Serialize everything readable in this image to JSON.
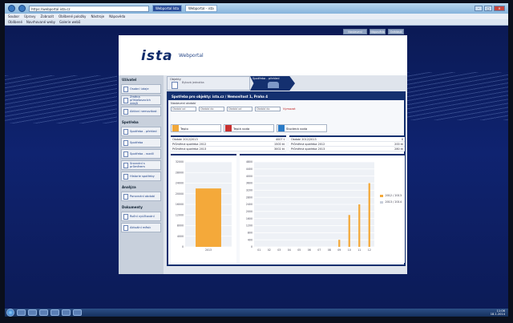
{
  "browser": {
    "address": "https://webportal.ista.cz",
    "tabs": [
      {
        "label": "Webportal Ista"
      },
      {
        "label": "Webportal - ista"
      }
    ],
    "menu": [
      "Soubor",
      "Úpravy",
      "Zobrazit",
      "Oblíbené položky",
      "Nástroje",
      "Nápověda"
    ],
    "favorites": [
      "Oblíbené",
      "Navrhované weby",
      "Galerie webů"
    ]
  },
  "header": {
    "logo": "ista",
    "portal_title": "Webportal",
    "buttons": [
      "Nastavení",
      "Nápověda",
      "Odhlásit"
    ]
  },
  "sidebar": {
    "sections": [
      {
        "title": "Uživatel",
        "items": [
          "Osobní údaje",
          "Změna přihlašovacích údajů",
          "Aktivní nemovitost"
        ]
      },
      {
        "title": "Spotřeba",
        "items": [
          "Spotřeba - přehled",
          "Spotřeba",
          "Spotřeba - rozdíl"
        ]
      },
      {
        "title": "",
        "items": [
          "Srovnání s průměrem",
          "Historie spotřeby"
        ]
      },
      {
        "title": "Analýza",
        "items": [
          "Porovnání období"
        ]
      },
      {
        "title": "Dokumenty",
        "items": [
          "Roční vyúčtování",
          "Aktuální měsíc"
        ]
      }
    ]
  },
  "steps": {
    "step1_title": "Objekty",
    "step1_sub": "Bytová jednotka",
    "step2_title": "Spotřeba - přehled"
  },
  "panel": {
    "title": "Spotřeba pro objekty: ista.cz / Nemovitost 1, Praha 4",
    "filter_label": "Nastavení období",
    "filters": [
      "Období od",
      "Období do",
      "Období od",
      "Období do"
    ],
    "reset": "Vymazat"
  },
  "cards": [
    {
      "label": "Teplo",
      "color": "#f2a93b"
    },
    {
      "label": "Teplá voda",
      "color": "#c8302f"
    },
    {
      "label": "Studená voda",
      "color": "#2a7bc7"
    }
  ],
  "tables": {
    "left": [
      {
        "k": "Období 2012/2013",
        "v": "4007 t"
      },
      {
        "k": "Průměrná spotřeba 2012",
        "v": "1500 kt"
      },
      {
        "k": "Průměrná spotřeba 2013",
        "v": "3002 kt"
      }
    ],
    "right": [
      {
        "k": "Období 2012/2013",
        "v": "0"
      },
      {
        "k": "Průměrná spotřeba 2012",
        "v": "200 kt"
      },
      {
        "k": "Průměrná spotřeba 2013",
        "v": "280 kt"
      }
    ]
  },
  "chart_data": [
    {
      "type": "bar",
      "categories": [
        "2013"
      ],
      "values": [
        22000
      ],
      "ylim": [
        0,
        32000
      ],
      "yticks": [
        0,
        4000,
        8000,
        12000,
        16000,
        20000,
        24000,
        28000,
        32000
      ],
      "color": "#f4a93a"
    },
    {
      "type": "bar",
      "categories": [
        "01",
        "02",
        "03",
        "04",
        "05",
        "06",
        "07",
        "08",
        "09",
        "10",
        "11",
        "12"
      ],
      "series": [
        {
          "name": "2012 / 2013",
          "color": "#f4a93a",
          "values": [
            0,
            0,
            0,
            0,
            0,
            0,
            0,
            0,
            400,
            1800,
            2400,
            3600
          ]
        },
        {
          "name": "2013 / 2014",
          "color": "#c9cfdb",
          "values": [
            0,
            0,
            0,
            0,
            0,
            0,
            0,
            0,
            0,
            0,
            0,
            0
          ]
        }
      ],
      "ylim": [
        0,
        4800
      ],
      "yticks": [
        0,
        400,
        800,
        1200,
        1600,
        2000,
        2400,
        2800,
        3200,
        3600,
        4000,
        4400,
        4800
      ]
    }
  ],
  "taskbar": {
    "time": "11:06",
    "date": "18.1.2014"
  }
}
